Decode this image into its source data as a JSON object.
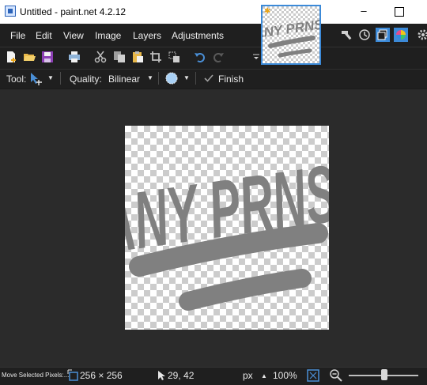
{
  "window": {
    "title": "Untitled - paint.net 4.2.12"
  },
  "menu": [
    {
      "label": "File"
    },
    {
      "label": "Edit"
    },
    {
      "label": "View"
    },
    {
      "label": "Image"
    },
    {
      "label": "Layers"
    },
    {
      "label": "Adjustments"
    }
  ],
  "tool_options": {
    "tool_label": "Tool:",
    "quality_label": "Quality:",
    "quality_value": "Bilinear",
    "finish_label": "Finish"
  },
  "canvas_image": {
    "text": "ANY PRNS.",
    "ink_color": "#808080"
  },
  "thumbnail": {
    "text": "ANY PRNS."
  },
  "status": {
    "hint": "Move Selected Pixels:...",
    "image_size": "256 × 256",
    "cursor_pos": "29, 42",
    "units": "px",
    "zoom": "100%"
  },
  "colors": {
    "accent": "#3c8ad8",
    "dark_bg": "#1f1f1f",
    "workspace_bg": "#2b2b2b"
  }
}
